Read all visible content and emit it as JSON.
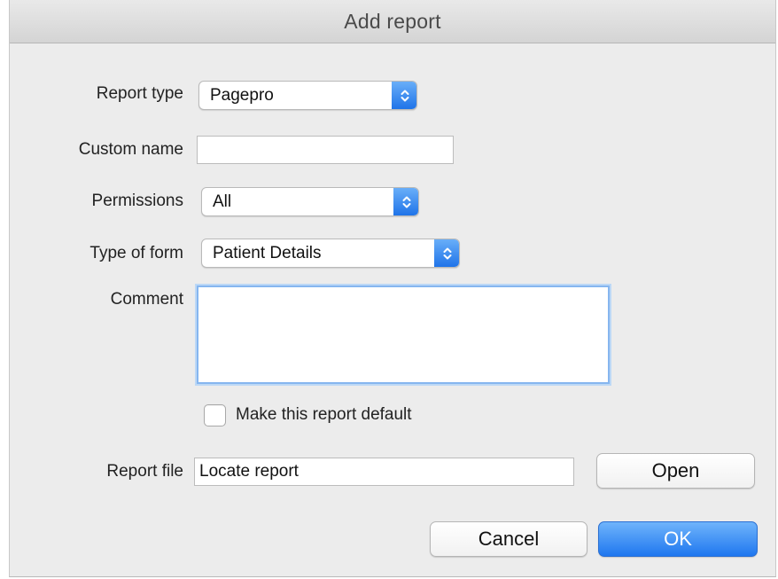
{
  "window": {
    "title": "Add report"
  },
  "form": {
    "report_type": {
      "label": "Report type",
      "value": "Pagepro"
    },
    "custom_name": {
      "label": "Custom name",
      "value": ""
    },
    "permissions": {
      "label": "Permissions",
      "value": "All"
    },
    "type_of_form": {
      "label": "Type of form",
      "value": "Patient Details"
    },
    "comment": {
      "label": "Comment",
      "value": ""
    },
    "default_checkbox": {
      "label": "Make this report default",
      "checked": false
    },
    "report_file": {
      "label": "Report file",
      "value": "Locate report"
    }
  },
  "buttons": {
    "open": "Open",
    "cancel": "Cancel",
    "ok": "OK"
  },
  "colors": {
    "accent": "#1f77ef",
    "focus_ring": "#86b6ef",
    "titlebar": "#dcdcdc"
  },
  "icons": {
    "popup_stepper": "chevron-up-down-icon"
  }
}
